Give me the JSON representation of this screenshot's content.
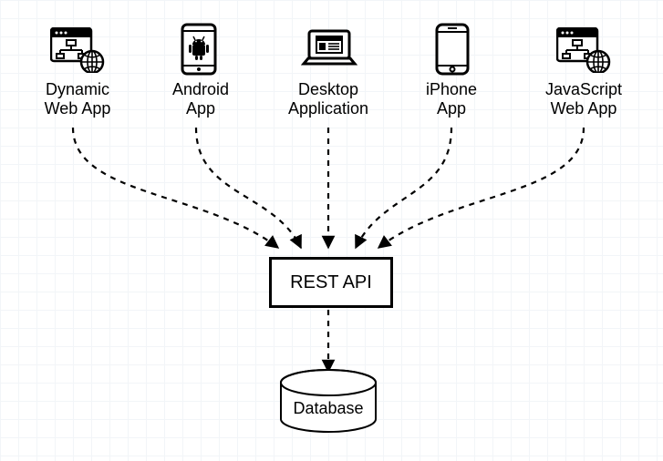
{
  "clients": [
    {
      "id": "dynamic-web-app",
      "label": "Dynamic\nWeb App"
    },
    {
      "id": "android-app",
      "label": "Android\nApp"
    },
    {
      "id": "desktop-app",
      "label": "Desktop\nApplication"
    },
    {
      "id": "iphone-app",
      "label": "iPhone\nApp"
    },
    {
      "id": "js-web-app",
      "label": "JavaScript\nWeb App"
    }
  ],
  "middle": {
    "label": "REST API"
  },
  "store": {
    "label": "Database"
  },
  "colors": {
    "stroke": "#000",
    "grid": "#f2f5f8"
  }
}
